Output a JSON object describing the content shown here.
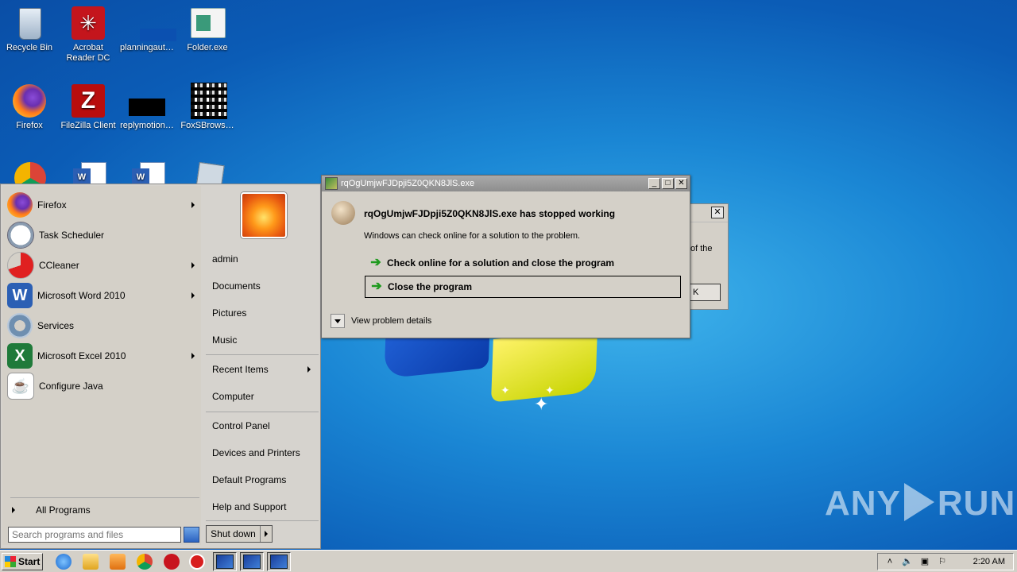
{
  "desktop": {
    "icons": [
      {
        "label": "Recycle Bin",
        "icon": "recycle-bin-icon"
      },
      {
        "label": "Acrobat\nReader DC",
        "label1": "Acrobat",
        "label2": "Reader DC",
        "icon": "acrobat-icon"
      },
      {
        "label": "planningaut…",
        "icon": "blank-file-icon"
      },
      {
        "label": "Folder.exe",
        "icon": "window-app-icon"
      },
      {
        "label": "Firefox",
        "icon": "firefox-icon"
      },
      {
        "label": "FileZilla Client",
        "icon": "filezilla-icon"
      },
      {
        "label": "replymotion…",
        "icon": "black-file-icon"
      },
      {
        "label": "FoxSBrows…",
        "icon": "qr-file-icon"
      },
      {
        "label": "",
        "icon": "chrome-icon"
      },
      {
        "label": "",
        "icon": "word-doc-icon"
      },
      {
        "label": "",
        "icon": "word-doc-icon"
      },
      {
        "label": "",
        "icon": "notepad-icon"
      }
    ],
    "watermark": {
      "left": "ANY",
      "right": "RUN"
    }
  },
  "start_menu": {
    "programs": [
      {
        "label": "Firefox",
        "icon": "firefox-icon",
        "submenu": true
      },
      {
        "label": "Task Scheduler",
        "icon": "clock-icon",
        "submenu": false
      },
      {
        "label": "CCleaner",
        "icon": "ccleaner-icon",
        "submenu": true
      },
      {
        "label": "Microsoft Word 2010",
        "icon": "word-icon",
        "submenu": true
      },
      {
        "label": "Services",
        "icon": "gears-icon",
        "submenu": false
      },
      {
        "label": "Microsoft Excel 2010",
        "icon": "excel-icon",
        "submenu": true
      },
      {
        "label": "Configure Java",
        "icon": "java-icon",
        "submenu": false
      }
    ],
    "all_programs": "All Programs",
    "search_placeholder": "Search programs and files",
    "right": {
      "user": "admin",
      "documents": "Documents",
      "pictures": "Pictures",
      "music": "Music",
      "recent_items": "Recent Items",
      "computer": "Computer",
      "control_panel": "Control Panel",
      "devices_printers": "Devices and Printers",
      "default_programs": "Default Programs",
      "help_support": "Help and Support"
    },
    "shutdown": "Shut down"
  },
  "background_dialog": {
    "text_fragment": "of the",
    "ok_fragment": "K"
  },
  "error_dialog": {
    "title": "rqOgUmjwFJDpji5Z0QKN8JlS.exe",
    "heading": "rqOgUmjwFJDpji5Z0QKN8JlS.exe has stopped working",
    "subtext": "Windows can check online for a solution to the problem.",
    "option_check": "Check online for a solution and close the program",
    "option_close": "Close the program",
    "details": "View problem details"
  },
  "taskbar": {
    "start": "Start",
    "clock": "2:20 AM",
    "pinned": [
      "ie-icon",
      "explorer-icon",
      "media-player-icon",
      "chrome-icon",
      "stop-icon",
      "error-icon"
    ],
    "tasks": 3
  },
  "colors": {
    "desktop_blue": "#1a86d4",
    "dialog_gray": "#d4d0c8",
    "green_arrow": "#1e9a1e"
  }
}
